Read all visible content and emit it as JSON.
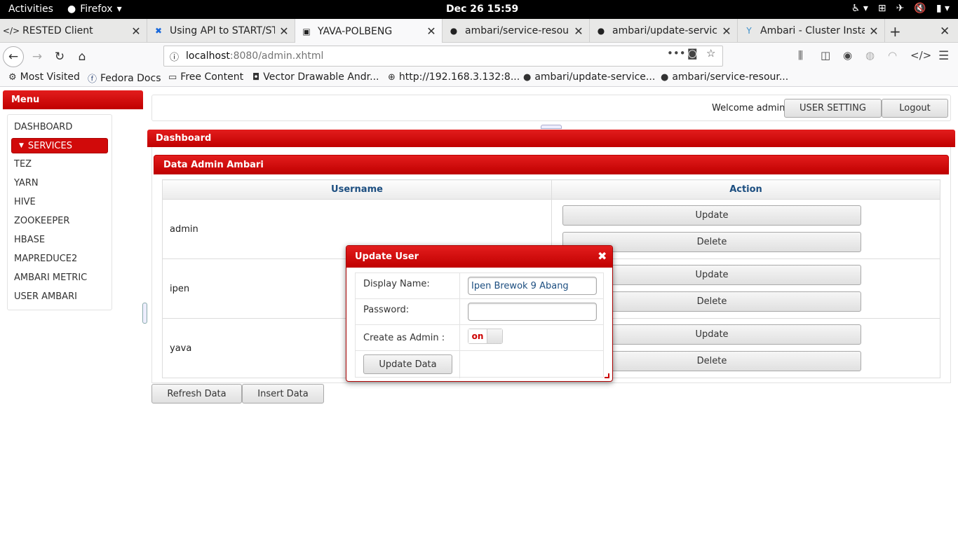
{
  "system": {
    "activities": "Activities",
    "app_name": "Firefox",
    "clock": "Dec 26  15:59"
  },
  "browser": {
    "tabs": [
      {
        "title": "RESTED Client",
        "icon": "code-icon"
      },
      {
        "title": "Using API to START/ST",
        "icon": "confluence-icon"
      },
      {
        "title": "YAVA-POLBENG",
        "icon": "page-icon"
      },
      {
        "title": "ambari/service-resour",
        "icon": "github-icon"
      },
      {
        "title": "ambari/update-service",
        "icon": "github-icon"
      },
      {
        "title": "Ambari - Cluster Instal",
        "icon": "ambari-icon"
      }
    ],
    "url_host": "localhost",
    "url_path": ":8080/admin.xhtml",
    "bookmarks": [
      {
        "label": "Most Visited",
        "icon": "gear-icon"
      },
      {
        "label": "Fedora Docs",
        "icon": "fedora-icon"
      },
      {
        "label": "Free Content",
        "icon": "folder-icon"
      },
      {
        "label": "Vector Drawable Andr...",
        "icon": "bookmark-icon"
      },
      {
        "label": "http://192.168.3.132:8...",
        "icon": "globe-icon"
      },
      {
        "label": "ambari/update-service...",
        "icon": "github-icon"
      },
      {
        "label": "ambari/service-resour...",
        "icon": "github-icon"
      }
    ]
  },
  "sidebar": {
    "title": "Menu",
    "items": [
      {
        "label": "DASHBOARD"
      },
      {
        "label": "SERVICES"
      },
      {
        "label": "TEZ"
      },
      {
        "label": "YARN"
      },
      {
        "label": "HIVE"
      },
      {
        "label": "ZOOKEEPER"
      },
      {
        "label": "HBASE"
      },
      {
        "label": "MAPREDUCE2"
      },
      {
        "label": "AMBARI METRIC"
      },
      {
        "label": "USER AMBARI"
      }
    ]
  },
  "header": {
    "welcome": "Welcome admin",
    "user_setting": "USER SETTING",
    "logout": "Logout"
  },
  "dashboard": {
    "title": "Dashboard",
    "panel_title": "Data Admin Ambari",
    "columns": [
      "Username",
      "Action"
    ],
    "rows": [
      {
        "username": "admin"
      },
      {
        "username": "ipen"
      },
      {
        "username": "yava"
      }
    ],
    "update_label": "Update",
    "delete_label": "Delete",
    "refresh_label": "Refresh Data",
    "insert_label": "Insert Data"
  },
  "dialog": {
    "title": "Update User",
    "display_name_label": "Display Name:",
    "display_name_value": "Ipen Brewok 9 Abang",
    "password_label": "Password:",
    "password_value": "",
    "admin_label": "Create as Admin :",
    "admin_toggle": "on",
    "submit_label": "Update Data"
  },
  "colors": {
    "accent_red": "#c00000",
    "header_text_blue": "#1c4e80"
  }
}
